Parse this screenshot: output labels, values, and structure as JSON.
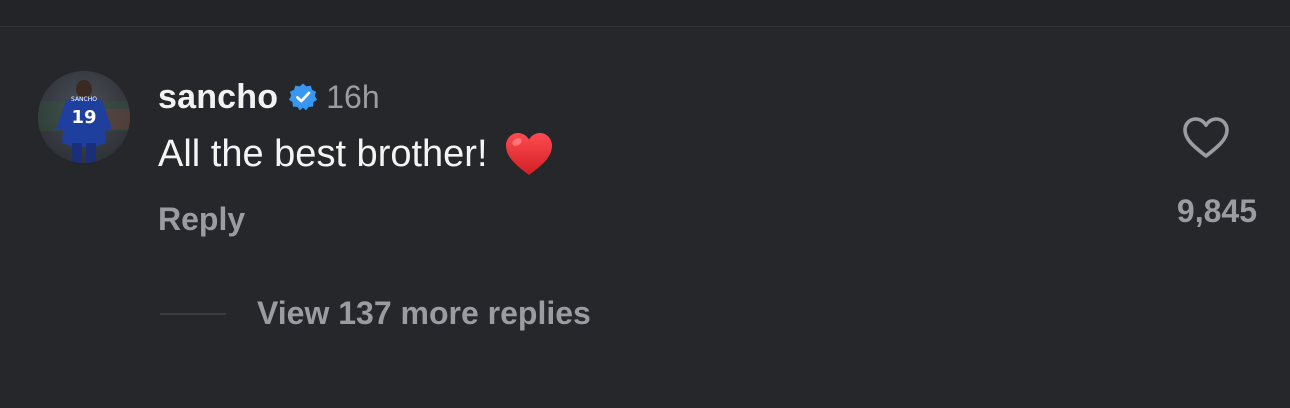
{
  "comment": {
    "username": "sancho",
    "verified": true,
    "time": "16h",
    "text": "All the best brother!",
    "emoji": "red-heart",
    "reply_label": "Reply",
    "like_count": "9,845",
    "view_replies_label": "View 137 more replies"
  },
  "colors": {
    "background": "#25272b",
    "primary_text": "#f2f2f2",
    "secondary_text": "#9a9ca1",
    "verified_badge": "#3897f0",
    "heart_emoji": "#e0282e"
  },
  "icons": {
    "verified": "verified-badge-icon",
    "like": "heart-outline-icon",
    "avatar": "profile-photo"
  }
}
